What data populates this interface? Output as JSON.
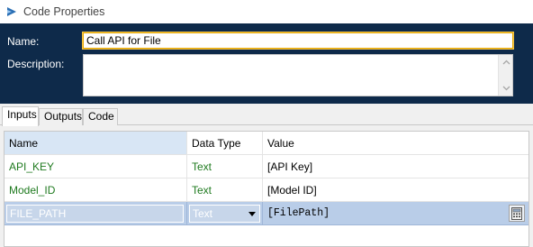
{
  "window": {
    "title": "Code Properties",
    "icon": "code-stage-icon"
  },
  "header": {
    "name_label": "Name:",
    "name_value": "Call API for File",
    "description_label": "Description:",
    "description_value": ""
  },
  "tabs": [
    {
      "label": "Inputs",
      "active": true
    },
    {
      "label": "Outputs",
      "active": false
    },
    {
      "label": "Code",
      "active": false
    }
  ],
  "grid": {
    "columns": [
      "Name",
      "Data Type",
      "Value"
    ],
    "rows": [
      {
        "name": "API_KEY",
        "type": "Text",
        "value": "[API Key]"
      },
      {
        "name": "Model_ID",
        "type": "Text",
        "value": "[Model ID]"
      },
      {
        "name": "FILE_PATH",
        "type": "Text",
        "value": "[FilePath]",
        "selected": true
      }
    ]
  },
  "colors": {
    "header_bg": "#0e2a4a",
    "selection": "#b9cde8",
    "name_text": "#1f7a1f",
    "focus_border": "#e6a700"
  }
}
